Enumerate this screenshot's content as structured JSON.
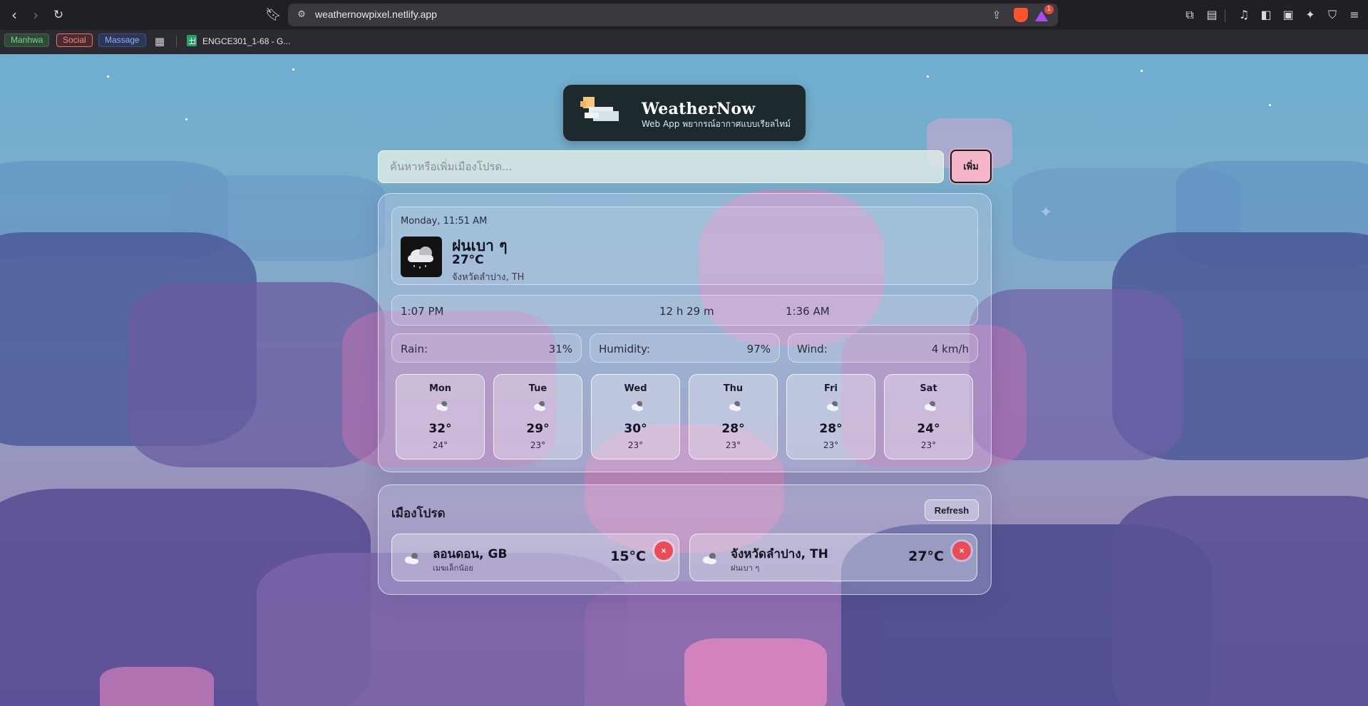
{
  "browser": {
    "url": "weathernowpixel.netlify.app",
    "rewards_badge": "1",
    "bookmarks": [
      "Manhwa",
      "Social",
      "Massage"
    ],
    "bookmark_sheet": "ENGCE301_1-68 - G..."
  },
  "brand": {
    "title": "WeatherNow",
    "subtitle": "Web App พยากรณ์อากาศแบบเรียลไทม์"
  },
  "search": {
    "placeholder": "ค้นหาหรือเพิ่มเมืองโปรด...",
    "add_label": "เพิ่ม"
  },
  "current": {
    "datetime": "Monday, 11:51 AM",
    "condition": "ฝนเบา ๆ",
    "temp": "27°C",
    "location": "จังหวัดลำปาง, TH",
    "icon": "rain-cloud-icon"
  },
  "sun": {
    "sunrise": "1:07 PM",
    "day_length": "12 h 29 m",
    "sunset": "1:36 AM"
  },
  "stats": [
    {
      "label": "Rain:",
      "value": "31%"
    },
    {
      "label": "Humidity:",
      "value": "97%"
    },
    {
      "label": "Wind:",
      "value": "4 km/h"
    }
  ],
  "forecast": [
    {
      "day": "Mon",
      "high": "32°",
      "low": "24°"
    },
    {
      "day": "Tue",
      "high": "29°",
      "low": "23°"
    },
    {
      "day": "Wed",
      "high": "30°",
      "low": "23°"
    },
    {
      "day": "Thu",
      "high": "28°",
      "low": "23°"
    },
    {
      "day": "Fri",
      "high": "28°",
      "low": "23°"
    },
    {
      "day": "Sat",
      "high": "24°",
      "low": "23°"
    }
  ],
  "favorites": {
    "title": "เมืองโปรด",
    "refresh_label": "Refresh",
    "remove_label": "×",
    "cities": [
      {
        "name": "ลอนดอน, GB",
        "desc": "เมฆเล็กน้อย",
        "temp": "15°C"
      },
      {
        "name": "จังหวัดลำปาง, TH",
        "desc": "ฝนเบา ๆ",
        "temp": "27°C"
      }
    ]
  },
  "colors": {
    "accent_pink": "#f4b6c8",
    "remove_red": "#ec4a56",
    "brand_bg": "#1d2a2d"
  }
}
